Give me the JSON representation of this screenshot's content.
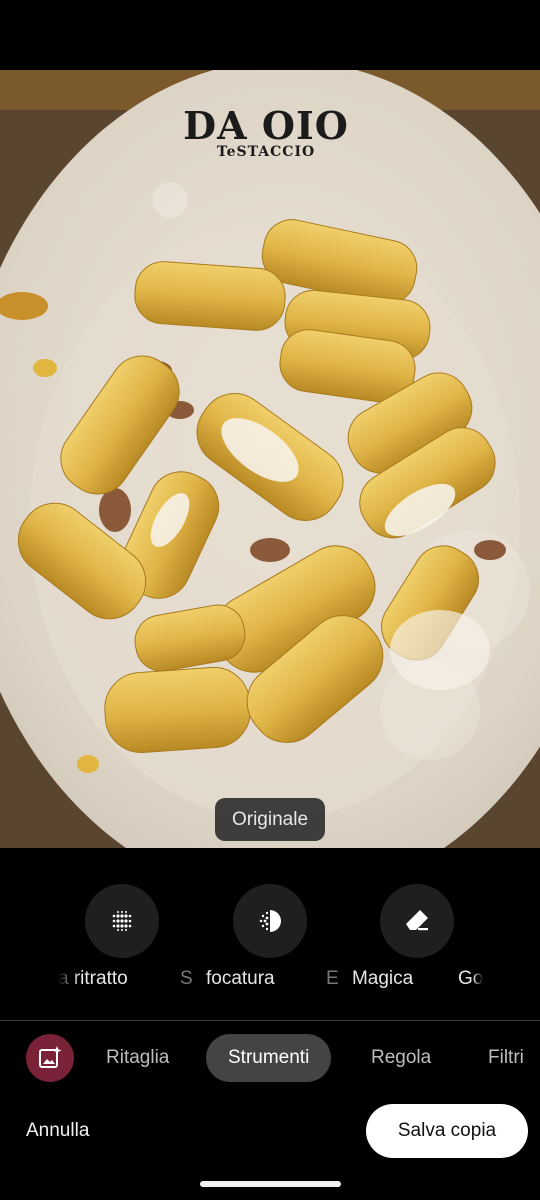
{
  "photo": {
    "logo_main": "DA OIO",
    "logo_sub": "TeSTACCIO"
  },
  "overlay": {
    "original_label": "Originale"
  },
  "tools": [
    {
      "label": "a ritratto",
      "icon": "portrait-light-icon"
    },
    {
      "label_prefix": "S",
      "label": "focatura",
      "icon": "blur-icon"
    },
    {
      "label_prefix": "E",
      "label": "Magica",
      "icon": "eraser-icon"
    },
    {
      "label": "Go",
      "icon": ""
    }
  ],
  "tabs": {
    "app_icon": "photo-sparkle-icon",
    "items": [
      "Ritaglia",
      "Strumenti",
      "Regola",
      "Filtri"
    ],
    "active": "Strumenti"
  },
  "actions": {
    "cancel_label": "Annulla",
    "save_label": "Salva copia"
  },
  "colors": {
    "background": "#000000",
    "active_tab": "#444444",
    "app_icon_bg": "#7a2238",
    "save_button": "#ffffff"
  }
}
